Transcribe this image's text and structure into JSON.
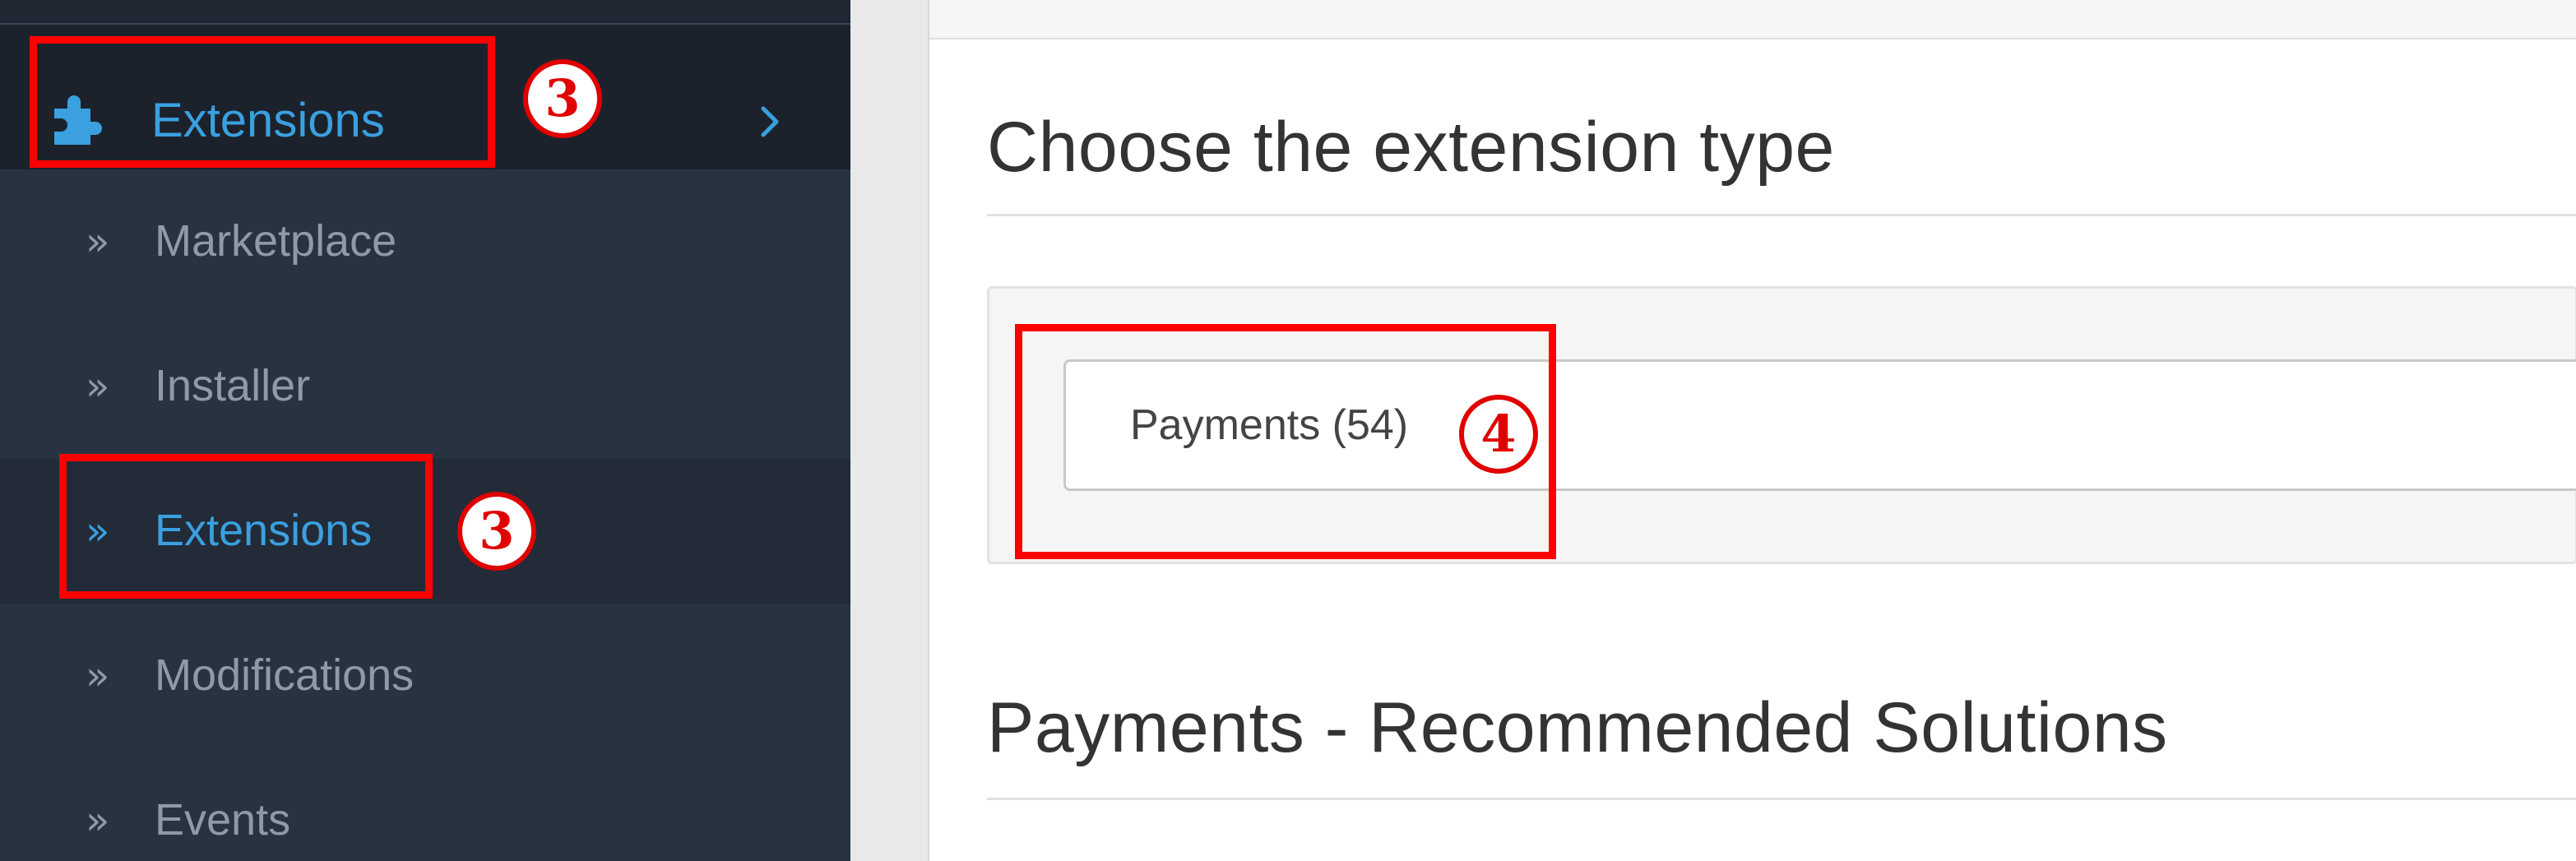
{
  "sidebar": {
    "parent": {
      "icon": "puzzle-icon",
      "label": "Extensions",
      "chevron_icon": "chevron-right-icon"
    },
    "items": [
      {
        "icon": "raquo-icon",
        "label": "Marketplace",
        "active": false
      },
      {
        "icon": "raquo-icon",
        "label": "Installer",
        "active": false
      },
      {
        "icon": "raquo-icon",
        "label": "Extensions",
        "active": true
      },
      {
        "icon": "raquo-icon",
        "label": "Modifications",
        "active": false
      },
      {
        "icon": "raquo-icon",
        "label": "Events",
        "active": false
      }
    ]
  },
  "main": {
    "heading": "Choose the extension type",
    "type_select": {
      "selected_value": "Payments (54)"
    },
    "section_heading": "Payments - Recommended Solutions"
  },
  "annotations": {
    "step_extensions_parent": "3",
    "step_extensions_item": "3",
    "step_type_select": "4"
  },
  "colors": {
    "sidebar_bg": "#283342",
    "sidebar_active_text": "#3aa0e0",
    "sidebar_text": "#8f9aa8",
    "annotation_red": "#ff0000"
  }
}
